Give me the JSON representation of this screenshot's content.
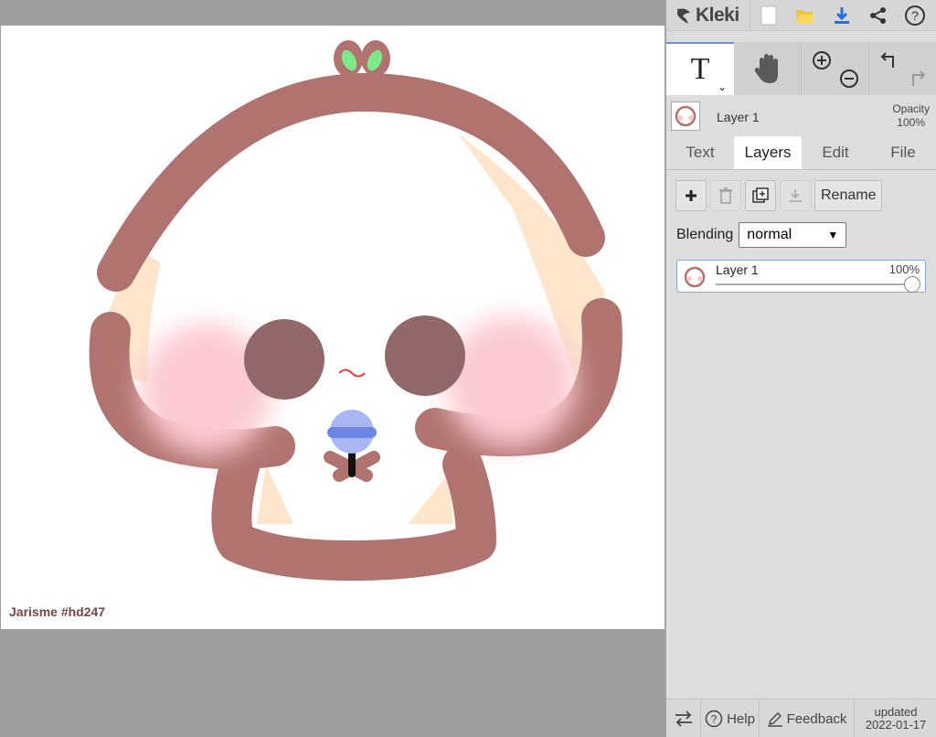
{
  "app": {
    "name": "Kleki"
  },
  "topbar": {
    "icons": [
      "new-file-icon",
      "open-folder-icon",
      "download-icon",
      "share-icon",
      "help-icon"
    ]
  },
  "tools": {
    "active": "text-tool",
    "items": [
      "text-tool",
      "hand-tool",
      "zoom-in-icon",
      "zoom-out-icon",
      "undo-icon",
      "redo-icon"
    ],
    "text_glyph": "T"
  },
  "layer_header": {
    "name": "Layer 1",
    "opacity_label": "Opacity",
    "opacity_value": "100%"
  },
  "tabs": [
    {
      "label": "Text",
      "active": false
    },
    {
      "label": "Layers",
      "active": true
    },
    {
      "label": "Edit",
      "active": false
    },
    {
      "label": "File",
      "active": false
    }
  ],
  "layer_tools": {
    "rename_label": "Rename"
  },
  "blending": {
    "label": "Blending",
    "value": "normal"
  },
  "layers": [
    {
      "name": "Layer 1",
      "opacity": "100%",
      "opacity_fraction": 1.0
    }
  ],
  "canvas": {
    "signature": "Jarisme #hd247"
  },
  "bottombar": {
    "help_label": "Help",
    "feedback_label": "Feedback",
    "updated_label": "updated",
    "updated_date": "2022-01-17"
  },
  "colors": {
    "accent": "#6c8fd6",
    "stroke_brown": "#b07370",
    "blush": "#fcc9d0",
    "eye": "#93686a",
    "cream": "#fde6cc",
    "leaf": "#7de88a",
    "mic_blue": "#a9b8f5"
  }
}
